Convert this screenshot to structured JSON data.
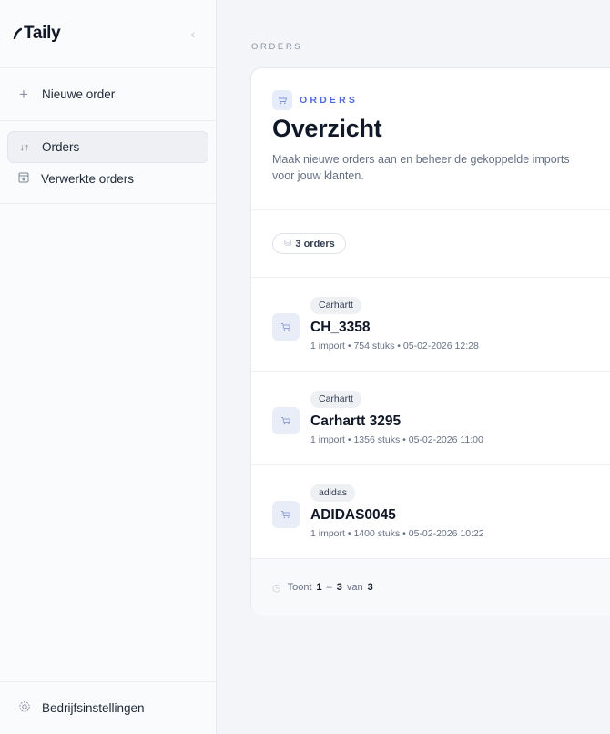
{
  "app": {
    "brand": "Taily",
    "collapse_icon": "chevron-left-icon"
  },
  "sidebar": {
    "new_order_label": "Nieuwe order",
    "items": [
      {
        "label": "Orders",
        "icon": "sort-arrows-icon",
        "active": true
      },
      {
        "label": "Verwerkte orders",
        "icon": "archive-download-icon",
        "active": false
      }
    ],
    "settings_label": "Bedrijfsinstellingen"
  },
  "breadcrumb": "ORDERS",
  "header": {
    "kicker": "ORDERS",
    "title": "Overzicht",
    "subtitle": "Maak nieuwe orders aan en beheer de gekoppelde imports voor jouw klanten."
  },
  "count_badge": "3 orders",
  "orders": [
    {
      "brand": "Carhartt",
      "name": "CH_3358",
      "meta": "1 import • 754 stuks • 05-02-2026 12:28"
    },
    {
      "brand": "Carhartt",
      "name": "Carhartt 3295",
      "meta": "1 import • 1356 stuks • 05-02-2026 11:00"
    },
    {
      "brand": "adidas",
      "name": "ADIDAS0045",
      "meta": "1 import • 1400 stuks • 05-02-2026 10:22"
    }
  ],
  "pagination": {
    "prefix": "Toont",
    "from": "1",
    "dash": "–",
    "to": "3",
    "of_word": "van",
    "total": "3"
  },
  "colors": {
    "accent": "#4f6bd8",
    "background": "#f3f5f9"
  }
}
